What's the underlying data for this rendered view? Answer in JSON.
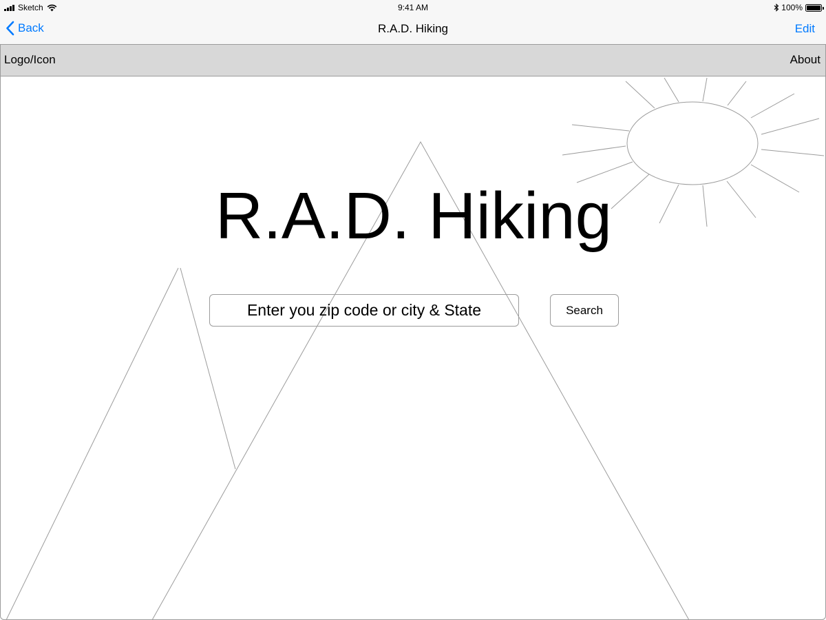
{
  "status_bar": {
    "carrier": "Sketch",
    "time": "9:41 AM",
    "battery": "100%",
    "battery_level": 1.0,
    "icons": [
      "signal-icon",
      "wifi-icon",
      "bluetooth-icon",
      "battery-icon"
    ]
  },
  "nav_bar": {
    "back_label": "Back",
    "title": "R.A.D. Hiking",
    "edit_label": "Edit",
    "accent_color": "#007aff"
  },
  "header": {
    "logo_label": "Logo/Icon",
    "about_label": "About",
    "background_color": "#d8d8d8"
  },
  "main": {
    "title": "R.A.D. Hiking",
    "search": {
      "placeholder": "Enter you zip code or city & State",
      "value": ""
    },
    "search_button_label": "Search",
    "illustration": [
      "sun-icon",
      "mountain-icon"
    ]
  }
}
